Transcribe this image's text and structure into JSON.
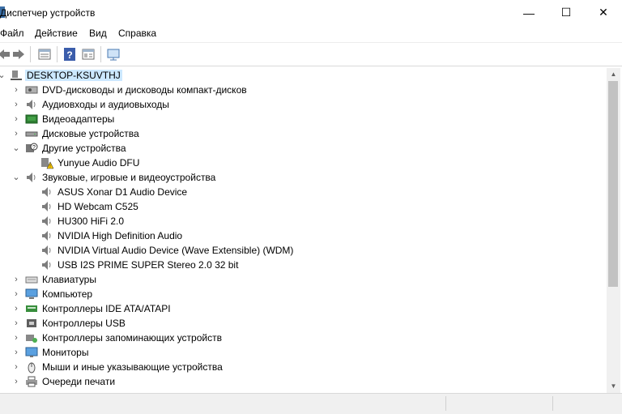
{
  "window": {
    "title": "Диспетчер устройств",
    "minimize": "—",
    "maximize": "☐",
    "close": "✕"
  },
  "menu": [
    "Файл",
    "Действие",
    "Вид",
    "Справка"
  ],
  "toolbar": {
    "icons": [
      "back-arrow-icon",
      "forward-arrow-icon",
      "properties-icon",
      "help-icon",
      "view-icon",
      "monitor-scan-icon"
    ]
  },
  "tree": {
    "root": "DESKTOP-KSUVTHJ",
    "items": [
      {
        "label": "DVD-дисководы и дисководы компакт-дисков",
        "level": 1,
        "expanded": false,
        "icon": "dvd-drive-icon"
      },
      {
        "label": "Аудиовходы и аудиовыходы",
        "level": 1,
        "expanded": false,
        "icon": "speaker-icon"
      },
      {
        "label": "Видеоадаптеры",
        "level": 1,
        "expanded": false,
        "icon": "display-adapter-icon"
      },
      {
        "label": "Дисковые устройства",
        "level": 1,
        "expanded": false,
        "icon": "disk-drive-icon"
      },
      {
        "label": "Другие устройства",
        "level": 1,
        "expanded": true,
        "icon": "unknown-device-icon"
      },
      {
        "label": "Yunyue Audio DFU",
        "level": 2,
        "icon": "warning-device-icon"
      },
      {
        "label": "Звуковые, игровые и видеоустройства",
        "level": 1,
        "expanded": true,
        "icon": "speaker-icon"
      },
      {
        "label": "ASUS Xonar D1 Audio Device",
        "level": 2,
        "icon": "speaker-icon"
      },
      {
        "label": "HD Webcam C525",
        "level": 2,
        "icon": "speaker-icon"
      },
      {
        "label": "HU300 HiFi 2.0",
        "level": 2,
        "icon": "speaker-icon"
      },
      {
        "label": "NVIDIA High Definition Audio",
        "level": 2,
        "icon": "speaker-icon"
      },
      {
        "label": "NVIDIA Virtual Audio Device (Wave Extensible) (WDM)",
        "level": 2,
        "icon": "speaker-icon"
      },
      {
        "label": "USB I2S PRIME SUPER Stereo 2.0 32 bit",
        "level": 2,
        "icon": "speaker-icon"
      },
      {
        "label": "Клавиатуры",
        "level": 1,
        "expanded": false,
        "icon": "keyboard-icon"
      },
      {
        "label": "Компьютер",
        "level": 1,
        "expanded": false,
        "icon": "computer-icon"
      },
      {
        "label": "Контроллеры IDE ATA/ATAPI",
        "level": 1,
        "expanded": false,
        "icon": "ide-controller-icon"
      },
      {
        "label": "Контроллеры USB",
        "level": 1,
        "expanded": false,
        "icon": "usb-controller-icon"
      },
      {
        "label": "Контроллеры запоминающих устройств",
        "level": 1,
        "expanded": false,
        "icon": "storage-controller-icon"
      },
      {
        "label": "Мониторы",
        "level": 1,
        "expanded": false,
        "icon": "monitor-icon"
      },
      {
        "label": "Мыши и иные указывающие устройства",
        "level": 1,
        "expanded": false,
        "icon": "mouse-icon"
      },
      {
        "label": "Очереди печати",
        "level": 1,
        "expanded": false,
        "icon": "printer-icon"
      }
    ]
  }
}
